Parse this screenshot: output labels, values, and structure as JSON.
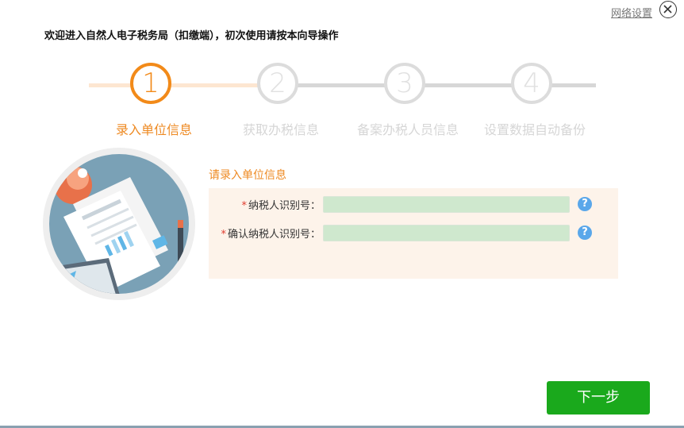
{
  "header": {
    "network_settings": "网络设置",
    "welcome": "欢迎进入自然人电子税务局（扣缴端），初次使用请按本向导操作"
  },
  "steps": [
    {
      "number": "1",
      "label": "录入单位信息",
      "active": true
    },
    {
      "number": "2",
      "label": "获取办税信息",
      "active": false
    },
    {
      "number": "3",
      "label": "备案办税人员信息",
      "active": false
    },
    {
      "number": "4",
      "label": "设置数据自动备份",
      "active": false
    }
  ],
  "form": {
    "title": "请录入单位信息",
    "fields": [
      {
        "required_mark": "*",
        "label": "纳税人识别号：",
        "value": "",
        "help": "?"
      },
      {
        "required_mark": "*",
        "label": "确认纳税人识别号：",
        "value": "",
        "help": "?"
      }
    ]
  },
  "footer": {
    "next_label": "下一步"
  },
  "colors": {
    "accent": "#f28a19",
    "inactive": "#dcdcdc",
    "field_bg": "#cfe8ce",
    "panel_bg": "#fdf3ea",
    "next_button": "#1aa91c",
    "help_icon": "#5aa7ea"
  }
}
